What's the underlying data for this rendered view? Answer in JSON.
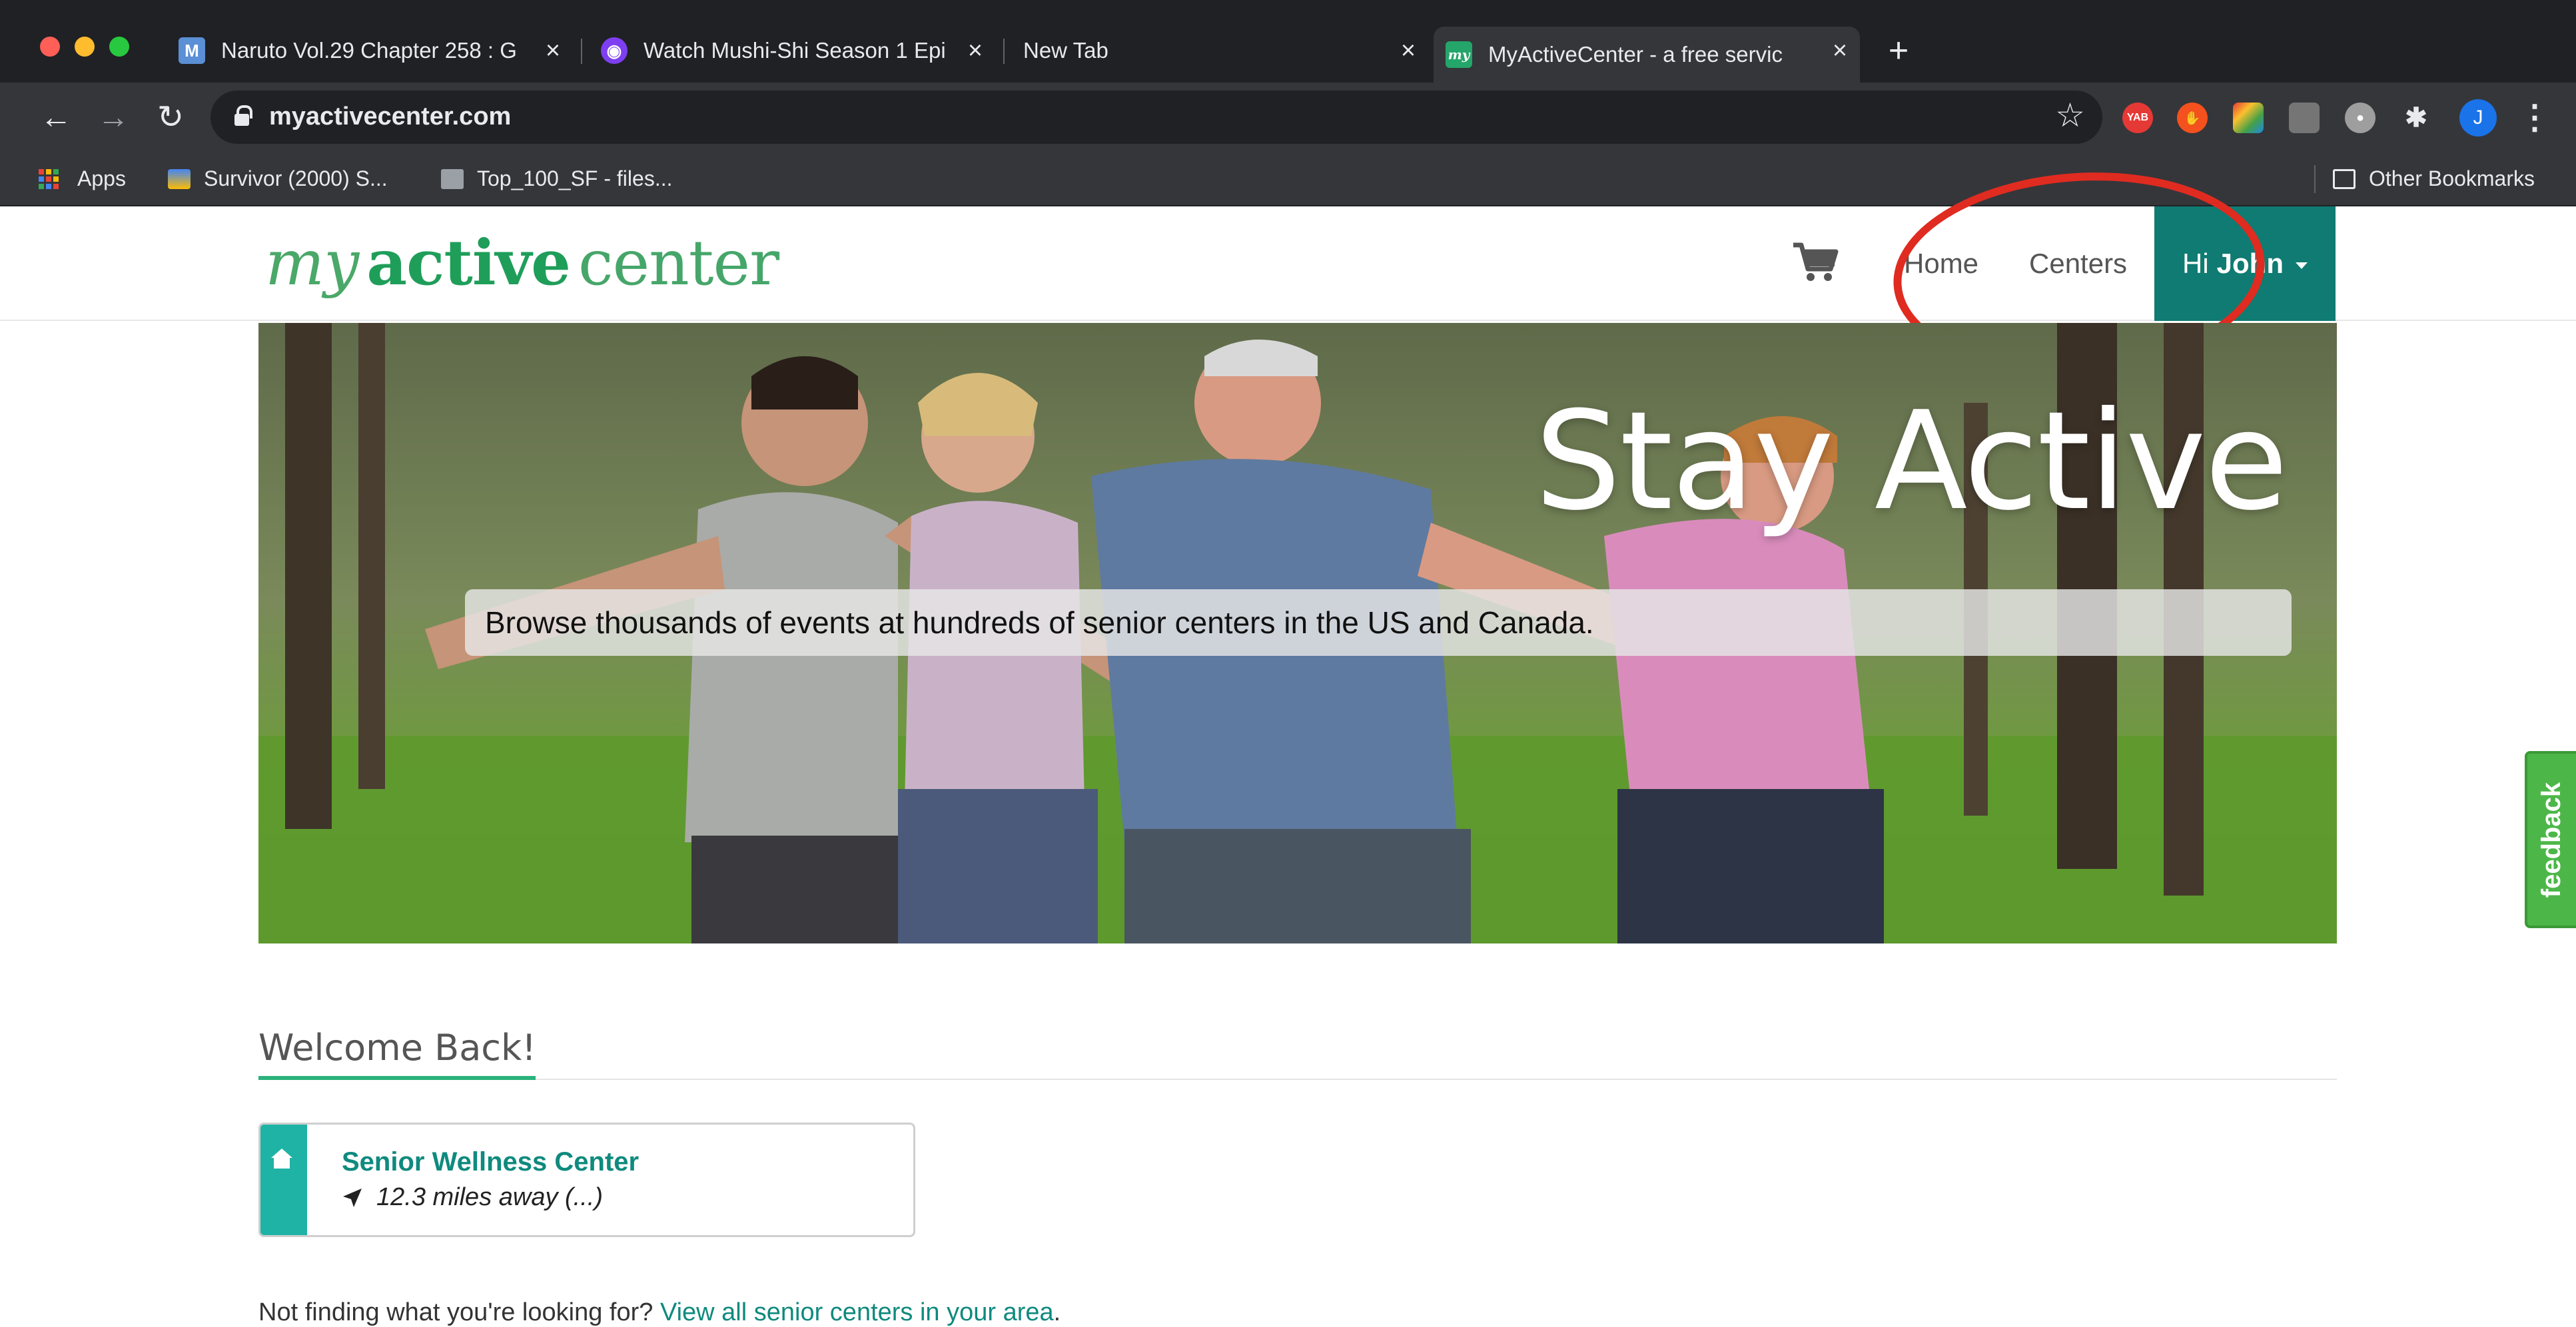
{
  "browser": {
    "tabs": [
      {
        "title": "Naruto Vol.29 Chapter 258 : G",
        "favicon": "manga-icon"
      },
      {
        "title": "Watch Mushi-Shi Season 1 Epi",
        "favicon": "anime-icon"
      },
      {
        "title": "New Tab",
        "favicon": ""
      },
      {
        "title": "MyActiveCenter - a free servic",
        "favicon": "my",
        "active": true
      }
    ],
    "new_tab_label": "+",
    "close_glyph": "×",
    "url": "myactivecenter.com",
    "extensions": [
      {
        "name": "yab-extension-icon",
        "label": "YAB",
        "color": "#e53935"
      },
      {
        "name": "hand-extension-icon",
        "label": "",
        "color": "#f4511e"
      },
      {
        "name": "color-extension-icon",
        "label": "",
        "color": "#43a047"
      },
      {
        "name": "grid-extension-icon",
        "label": "",
        "color": "#757575"
      },
      {
        "name": "circle-extension-icon",
        "label": "",
        "color": "#9e9e9e"
      }
    ],
    "profile_initial": "J",
    "bookmarks": [
      {
        "label": "Apps",
        "icon": "apps-grid-icon"
      },
      {
        "label": "Survivor (2000) S...",
        "icon": "survivor-icon"
      },
      {
        "label": "Top_100_SF - files...",
        "icon": "folder-icon"
      }
    ],
    "other_bookmarks": "Other Bookmarks"
  },
  "site": {
    "logo": {
      "my": "my",
      "active": "active",
      "center": "center"
    },
    "nav": {
      "home": "Home",
      "centers": "Centers"
    },
    "user": {
      "greeting": "Hi",
      "name": "John"
    },
    "hero": {
      "title": "Stay Active",
      "subtitle": "Browse thousands of events at hundreds of senior centers in the US and Canada."
    },
    "feedback_label": "feedback",
    "welcome_title": "Welcome Back!",
    "center_card": {
      "name": "Senior Wellness Center",
      "distance": "12.3 miles away (...)"
    },
    "footnote": {
      "text": "Not finding what you're looking for? ",
      "link": "View all senior centers in your area",
      "end": "."
    }
  },
  "colors": {
    "brand_green": "#1f9e5a",
    "teal": "#0f7b72",
    "annotation_red": "#e02b20",
    "feedback_green": "#4cb748"
  }
}
